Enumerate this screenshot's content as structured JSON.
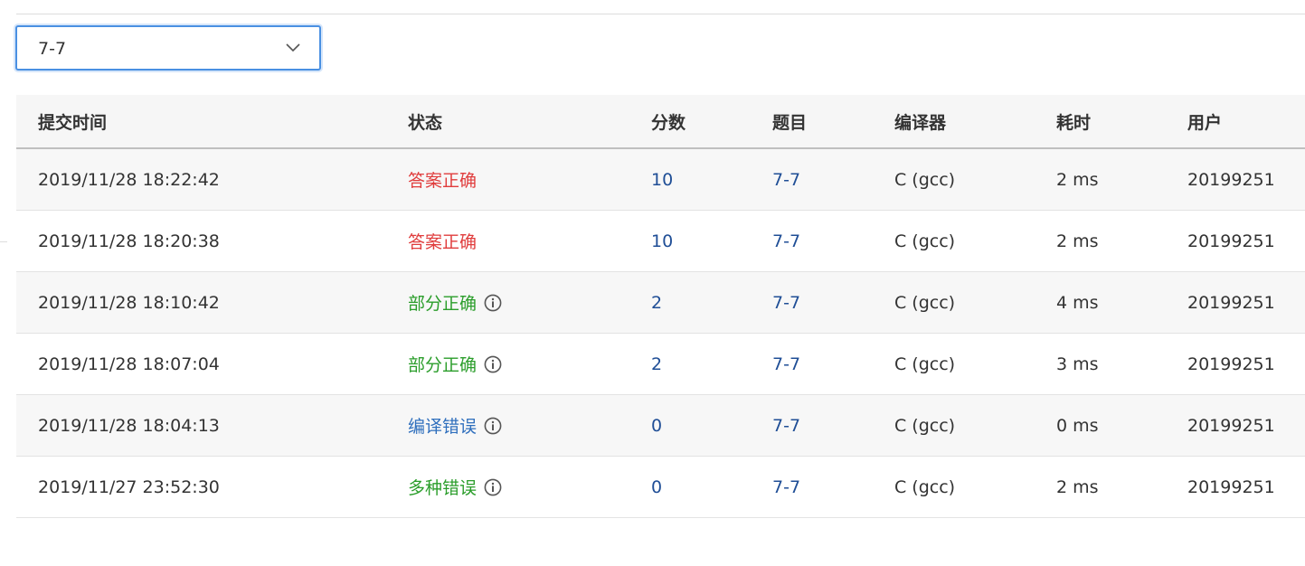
{
  "filter": {
    "selected": "7-7"
  },
  "table": {
    "headers": [
      "提交时间",
      "状态",
      "分数",
      "题目",
      "编译器",
      "耗时",
      "用户"
    ],
    "rows": [
      {
        "time": "2019/11/28 18:22:42",
        "status": "答案正确",
        "status_type": "accepted",
        "info": false,
        "score": "10",
        "problem": "7-7",
        "compiler": "C (gcc)",
        "duration": "2 ms",
        "user": "20199251"
      },
      {
        "time": "2019/11/28 18:20:38",
        "status": "答案正确",
        "status_type": "accepted",
        "info": false,
        "score": "10",
        "problem": "7-7",
        "compiler": "C (gcc)",
        "duration": "2 ms",
        "user": "20199251"
      },
      {
        "time": "2019/11/28 18:10:42",
        "status": "部分正确",
        "status_type": "partial",
        "info": true,
        "score": "2",
        "problem": "7-7",
        "compiler": "C (gcc)",
        "duration": "4 ms",
        "user": "20199251"
      },
      {
        "time": "2019/11/28 18:07:04",
        "status": "部分正确",
        "status_type": "partial",
        "info": true,
        "score": "2",
        "problem": "7-7",
        "compiler": "C (gcc)",
        "duration": "3 ms",
        "user": "20199251"
      },
      {
        "time": "2019/11/28 18:04:13",
        "status": "编译错误",
        "status_type": "compile",
        "info": true,
        "score": "0",
        "problem": "7-7",
        "compiler": "C (gcc)",
        "duration": "0 ms",
        "user": "20199251"
      },
      {
        "time": "2019/11/27 23:52:30",
        "status": "多种错误",
        "status_type": "multi",
        "info": true,
        "score": "0",
        "problem": "7-7",
        "compiler": "C (gcc)",
        "duration": "2 ms",
        "user": "20199251"
      }
    ]
  },
  "colors": {
    "accepted": "#e03c3c",
    "partial": "#2a9d2a",
    "compile_error": "#2f6fbd",
    "link": "#1f4e96",
    "select_border": "#4a90e2"
  },
  "icons": {
    "select_chevron": "chevron-down-icon",
    "status_info": "info-circle-icon"
  }
}
